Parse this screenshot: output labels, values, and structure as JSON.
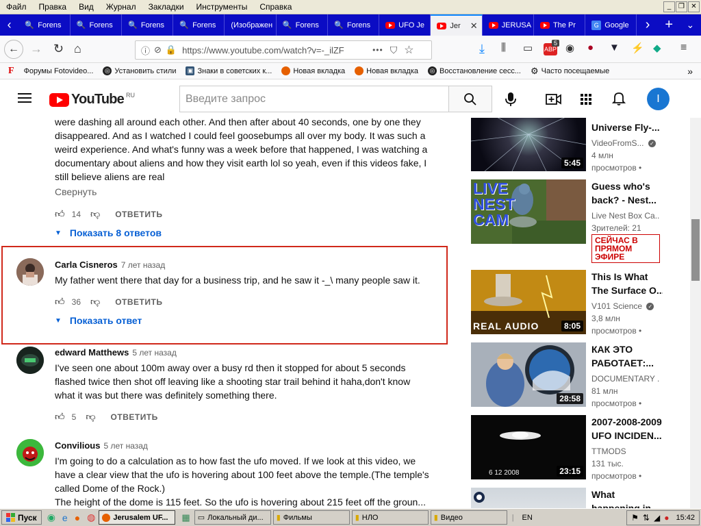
{
  "menubar": {
    "items": [
      "Файл",
      "Правка",
      "Вид",
      "Журнал",
      "Закладки",
      "Инструменты",
      "Справка"
    ]
  },
  "tabs": [
    {
      "label": "Forens",
      "icon": "magnifier-icon"
    },
    {
      "label": "Forens",
      "icon": "magnifier-icon"
    },
    {
      "label": "Forens",
      "icon": "magnifier-icon"
    },
    {
      "label": "Forens",
      "icon": "magnifier-icon"
    },
    {
      "label": "(Изображен",
      "icon": "none"
    },
    {
      "label": "Forens",
      "icon": "magnifier-icon"
    },
    {
      "label": "Forens",
      "icon": "magnifier-icon"
    },
    {
      "label": "UFO Je",
      "icon": "youtube-icon"
    },
    {
      "label": "Jer",
      "icon": "youtube-icon",
      "active": true
    },
    {
      "label": "JERUSA",
      "icon": "youtube-icon"
    },
    {
      "label": "The Pr",
      "icon": "youtube-icon"
    },
    {
      "label": "Google",
      "icon": "google-translate-icon"
    }
  ],
  "address": {
    "url": "https://www.youtube.com/watch?v=-_ilZF",
    "more": "•••",
    "badge_count": "5"
  },
  "bookmarks": [
    {
      "label": "Форумы Fotovideo...",
      "icon": "f-logo-icon"
    },
    {
      "label": "Установить стили",
      "icon": "globe-icon"
    },
    {
      "label": "Знаки в советских к...",
      "icon": "bookmark-icon"
    },
    {
      "label": "Новая вкладка",
      "icon": "firefox-icon"
    },
    {
      "label": "Новая вкладка",
      "icon": "firefox-icon"
    },
    {
      "label": "Восстановление сесс...",
      "icon": "globe-icon"
    },
    {
      "label": "Часто посещаемые",
      "icon": "gear-icon"
    }
  ],
  "youtube": {
    "logo_text": "YouTube",
    "region": "RU",
    "search_placeholder": "Введите запрос",
    "avatar_letter": "I"
  },
  "comments": {
    "partial": {
      "text": "were dashing all around each other. And then after about 40 seconds, one by one they disappeared. And as I watched I could feel goosebumps all over my body. It was such a weird experience. And what's funny was a week before that happened, I was watching a documentary about aliens and how they visit earth lol so yeah, even if this videos fake, I still believe aliens are real",
      "collapse_label": "Свернуть",
      "likes": "14",
      "reply_label": "ОТВЕТИТЬ",
      "show_replies": "Показать 8 ответов"
    },
    "highlighted": {
      "author": "Carla Cisneros",
      "time": "7 лет назад",
      "text": "My father went there that day for a business trip, and he saw it -_\\ many people saw it.",
      "likes": "36",
      "reply_label": "ОТВЕТИТЬ",
      "show_replies": "Показать ответ"
    },
    "edward": {
      "author": "edward Matthews",
      "time": "5 лет назад",
      "text": "I've seen one about 100m away over a busy rd then it stopped for about 5 seconds flashed twice then shot off leaving like a shooting star trail behind it haha,don't know what it was but there was definitely something there.",
      "likes": "5",
      "reply_label": "ОТВЕТИТЬ"
    },
    "convilious": {
      "author": "Convilious",
      "time": "5 лет назад",
      "text": "I'm going to do a calculation as to how fast the ufo moved. If we look at this video, we have a clear view that the ufo is hovering about 100 feet above the temple.(The temple's called Dome of the Rock.)",
      "text2": "The height of the dome is 115 feet. So the ufo is hovering about 215 feet off the groun..."
    }
  },
  "sidebar": [
    {
      "title": "Universe Fly-...",
      "channel": "VideoFromS...",
      "verified": true,
      "meta": [
        "4 млн",
        "просмотров •"
      ],
      "duration": "5:45"
    },
    {
      "title": [
        "Guess who's",
        "back? - Nest..."
      ],
      "channel": "Live Nest Box Ca...",
      "meta": [
        "Зрителей: 21"
      ],
      "live_badge": "СЕЙЧАС В ПРЯМОМ ЭФИРЕ",
      "thumb_text": "LIVE NEST CAM"
    },
    {
      "title": [
        "This Is What",
        "The Surface O..."
      ],
      "channel": "V101 Science",
      "verified": true,
      "meta": [
        "3,8 млн",
        "просмотров •"
      ],
      "duration": "8:05",
      "thumb_text": "REAL AUDIO"
    },
    {
      "title": [
        "КАК ЭТО",
        "РАБОТАЕТ:..."
      ],
      "channel": "DOCUMENTARY ...",
      "meta": [
        "81 млн",
        "просмотров •"
      ],
      "duration": "28:58"
    },
    {
      "title": [
        "2007-2008-2009",
        "UFO INCIDEN..."
      ],
      "channel": "TTMODS",
      "meta": [
        "131 тыс.",
        "просмотров •"
      ],
      "duration": "23:15",
      "thumb_text": "6 12 2008"
    },
    {
      "title": [
        "What",
        "happening in..."
      ]
    }
  ],
  "taskbar": {
    "start": "Пуск",
    "buttons": [
      "Jerusalem UF...",
      "Локальный ди...",
      "Фильмы",
      "НЛО",
      "Видео"
    ],
    "lang": "EN",
    "clock": "15:42"
  },
  "colors": {
    "tabstrip": "#0b0cc4",
    "link_blue": "#065fd4",
    "highlight_border": "#d0281a",
    "youtube_red": "#ff0000"
  }
}
